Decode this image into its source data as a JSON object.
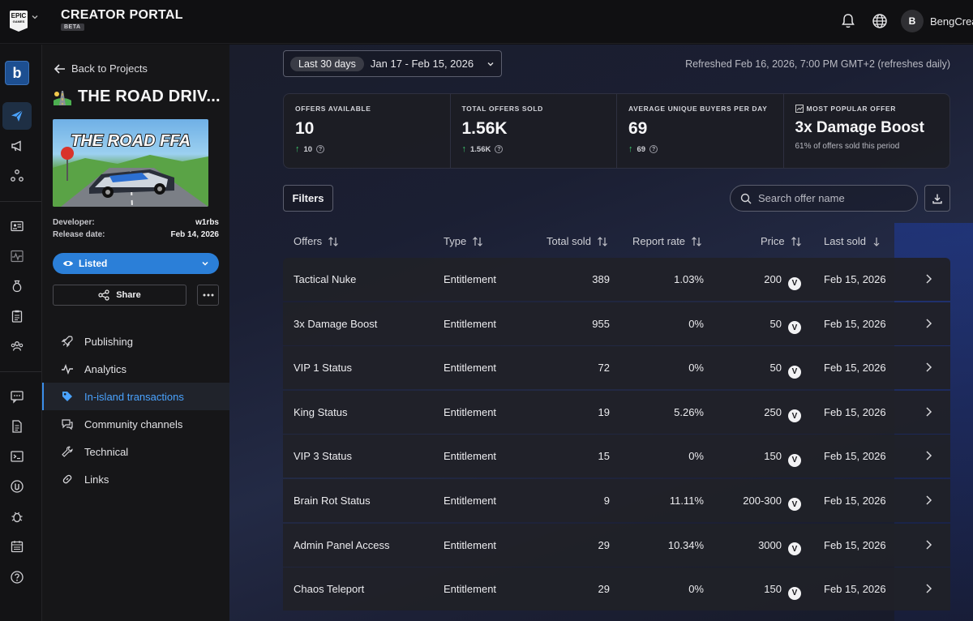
{
  "topbar": {
    "logo_line1": "EPIC",
    "logo_line2": "GAMES",
    "title": "CREATOR PORTAL",
    "badge": "BETA",
    "user_initial": "B",
    "user_name": "BengCrea"
  },
  "rail": {
    "brand_letter": "b",
    "items": [
      "send-icon",
      "megaphone-icon",
      "network-icon",
      "id-card-icon",
      "pulse-icon",
      "money-bag-icon",
      "clipboard-icon",
      "team-icon",
      "chat-icon",
      "document-icon",
      "terminal-icon",
      "unreal-icon",
      "bug-icon",
      "calendar-icon",
      "help-icon"
    ]
  },
  "sidebar": {
    "back_label": "Back to Projects",
    "project_emoji": "🛣️",
    "project_title": "THE ROAD DRIV...",
    "thumb_text": "THE ROAD FFA",
    "developer_label": "Developer:",
    "developer_value": "w1rbs",
    "release_label": "Release date:",
    "release_value": "Feb 14, 2026",
    "status_label": "Listed",
    "share_label": "Share",
    "nav": [
      {
        "label": "Publishing",
        "icon": "rocket-icon"
      },
      {
        "label": "Analytics",
        "icon": "pulse-icon"
      },
      {
        "label": "In-island transactions",
        "icon": "tag-icon"
      },
      {
        "label": "Community channels",
        "icon": "chat-bubbles-icon"
      },
      {
        "label": "Technical",
        "icon": "wrench-icon"
      },
      {
        "label": "Links",
        "icon": "link-icon"
      }
    ],
    "active_nav": "In-island transactions"
  },
  "toolbar": {
    "range_chip": "Last 30 days",
    "range": "Jan 17 - Feb 15, 2026",
    "refreshed": "Refreshed Feb 16, 2026, 7:00 PM GMT+2 (refreshes daily)"
  },
  "stats": {
    "offers_available": {
      "label": "OFFERS AVAILABLE",
      "value": "10",
      "delta": "10"
    },
    "total_sold": {
      "label": "TOTAL OFFERS SOLD",
      "value": "1.56K",
      "delta": "1.56K"
    },
    "avg_buyers": {
      "label": "AVERAGE UNIQUE BUYERS PER DAY",
      "value": "69",
      "delta": "69"
    },
    "popular": {
      "label": "MOST POPULAR OFFER",
      "value": "3x Damage Boost",
      "sub": "61% of offers sold this period"
    }
  },
  "controls": {
    "filters_label": "Filters",
    "search_placeholder": "Search offer name"
  },
  "table": {
    "columns": {
      "offers": "Offers",
      "type": "Type",
      "total_sold": "Total sold",
      "report_rate": "Report rate",
      "price": "Price",
      "last_sold": "Last sold"
    },
    "rows": [
      {
        "name": "Tactical Nuke",
        "type": "Entitlement",
        "sold": "389",
        "rate": "1.03%",
        "price": "200",
        "last": "Feb 15, 2026"
      },
      {
        "name": "3x Damage Boost",
        "type": "Entitlement",
        "sold": "955",
        "rate": "0%",
        "price": "50",
        "last": "Feb 15, 2026"
      },
      {
        "name": "VIP 1 Status",
        "type": "Entitlement",
        "sold": "72",
        "rate": "0%",
        "price": "50",
        "last": "Feb 15, 2026"
      },
      {
        "name": "King Status",
        "type": "Entitlement",
        "sold": "19",
        "rate": "5.26%",
        "price": "250",
        "last": "Feb 15, 2026"
      },
      {
        "name": "VIP 3 Status",
        "type": "Entitlement",
        "sold": "15",
        "rate": "0%",
        "price": "150",
        "last": "Feb 15, 2026"
      },
      {
        "name": "Brain Rot Status",
        "type": "Entitlement",
        "sold": "9",
        "rate": "11.11%",
        "price": "200-300",
        "last": "Feb 15, 2026"
      },
      {
        "name": "Admin Panel Access",
        "type": "Entitlement",
        "sold": "29",
        "rate": "10.34%",
        "price": "3000",
        "last": "Feb 15, 2026"
      },
      {
        "name": "Chaos Teleport",
        "type": "Entitlement",
        "sold": "29",
        "rate": "0%",
        "price": "150",
        "last": "Feb 15, 2026"
      }
    ],
    "currency_glyph": "V"
  },
  "colors": {
    "accent": "#2b7fd8",
    "active_nav": "#4aa3ff",
    "positive": "#3ecb6f"
  }
}
